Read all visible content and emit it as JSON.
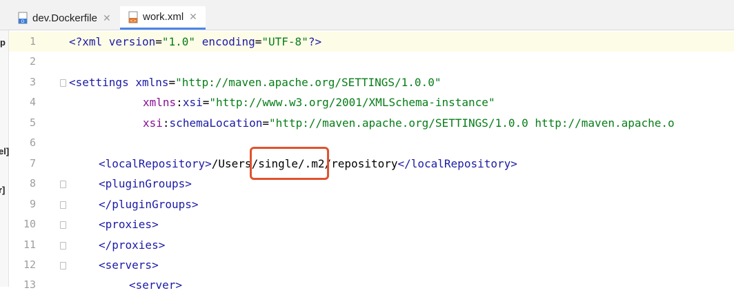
{
  "tabs": [
    {
      "label": "dev.Dockerfile",
      "active": false
    },
    {
      "label": "work.xml",
      "active": true
    }
  ],
  "left_strip": [
    "p",
    "el]",
    "r]"
  ],
  "line_numbers": [
    "1",
    "2",
    "3",
    "4",
    "5",
    "6",
    "7",
    "8",
    "9",
    "10",
    "11",
    "12",
    "13"
  ],
  "lines": {
    "l1": {
      "p1": "<?xml ",
      "a1": "version",
      "eq1": "=",
      "v1": "\"1.0\"",
      "sp": " ",
      "a2": "encoding",
      "eq2": "=",
      "v2": "\"UTF-8\"",
      "end": "?>"
    },
    "l3": {
      "open": "<settings ",
      "a": "xmlns",
      "eq": "=",
      "v": "\"http://maven.apache.org/SETTINGS/1.0.0\""
    },
    "l4": {
      "ns": "xmlns",
      "colon": ":",
      "a": "xsi",
      "eq": "=",
      "v": "\"http://www.w3.org/2001/XMLSchema-instance\""
    },
    "l5": {
      "ns": "xsi",
      "colon": ":",
      "a": "schemaLocation",
      "eq": "=",
      "v": "\"http://maven.apache.org/SETTINGS/1.0.0 http://maven.apache.o"
    },
    "l7": {
      "open": "<localRepository>",
      "text": "/Users/single/.m2/repository",
      "close": "</localRepository>"
    },
    "l8": "<pluginGroups>",
    "l9": "</pluginGroups>",
    "l10": "<proxies>",
    "l11": "</proxies>",
    "l12": "<servers>",
    "l13": "<server>"
  },
  "colors": {
    "tag": "#1a1aa6",
    "string": "#067d17",
    "namespace": "#871094",
    "highlight_box": "#e0522e",
    "current_line": "#fdfce6"
  }
}
